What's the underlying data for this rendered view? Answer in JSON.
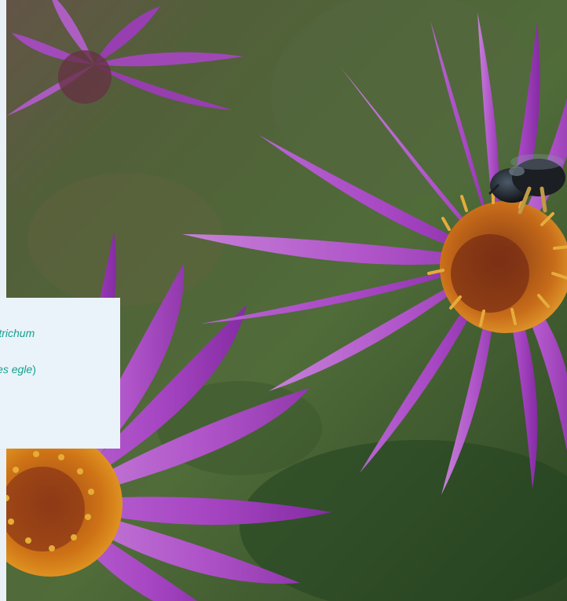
{
  "caption": {
    "text_part1": "Symphyotrichum",
    "text_part2": "Andrenides egle",
    "text_part3": ")"
  },
  "colors": {
    "caption_background": "#eaf3fa",
    "caption_text": "#14a08f",
    "petal": "#b64fd1",
    "flower_center": "#e18a1d",
    "foliage": "#4b6b36"
  },
  "image": {
    "subject": "purple asters with a bee on the center"
  }
}
